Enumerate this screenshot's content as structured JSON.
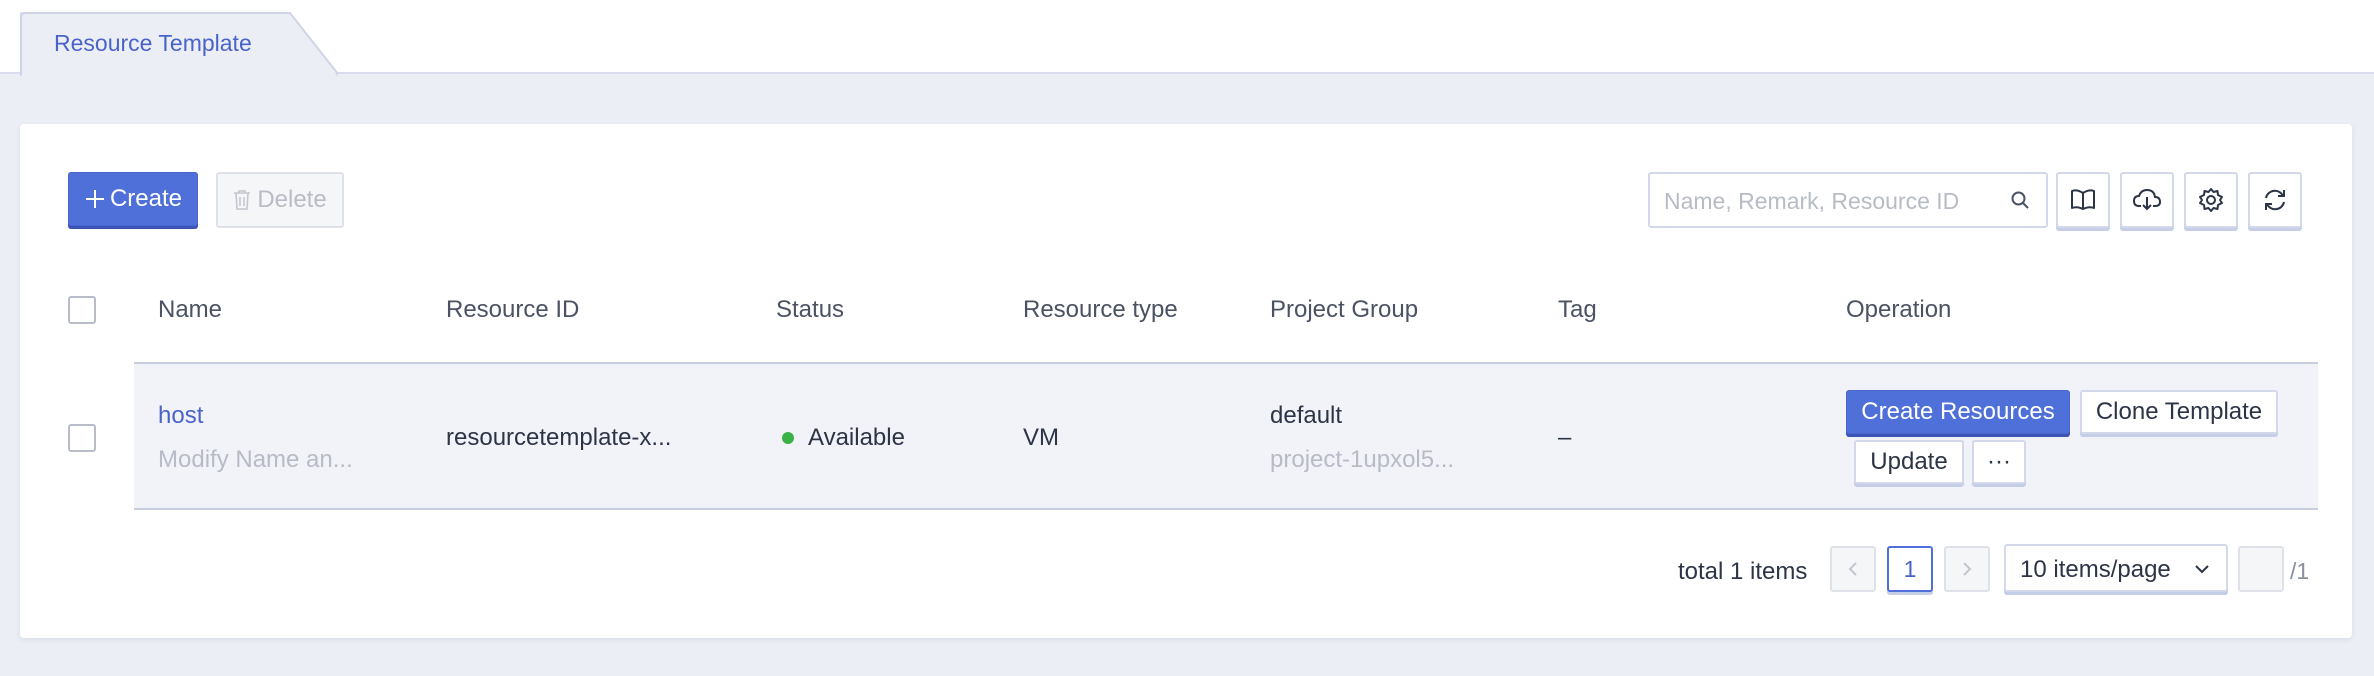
{
  "tabs": [
    {
      "label": "Resource Template"
    }
  ],
  "toolbar": {
    "create_label": "Create",
    "delete_label": "Delete",
    "search_placeholder": "Name, Remark, Resource ID"
  },
  "table": {
    "columns": [
      "Name",
      "Resource ID",
      "Status",
      "Resource type",
      "Project Group",
      "Tag",
      "Operation"
    ],
    "rows": [
      {
        "name": "host",
        "remark": "Modify Name an...",
        "resource_id": "resourcetemplate-x...",
        "status": "Available",
        "status_color": "#3bb046",
        "resource_type": "VM",
        "project_group": "default",
        "project_id": "project-1upxol5...",
        "tag": "–",
        "operations": [
          "Create Resources",
          "Clone Template",
          "Update",
          "···"
        ]
      }
    ]
  },
  "pagination": {
    "total_text": "total 1 items",
    "current_page": "1",
    "page_size": "10 items/page",
    "of_pages": "/1"
  },
  "colors": {
    "accent": "#4f6fd9",
    "link": "#4a63c9",
    "background": "#eceef5"
  }
}
